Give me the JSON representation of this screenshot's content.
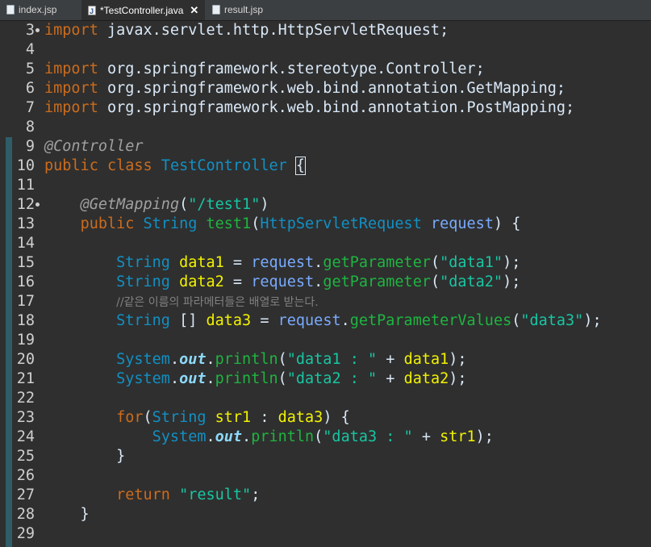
{
  "tabs": [
    {
      "label": "index.jsp",
      "icon": "jsp-file-icon",
      "active": false
    },
    {
      "label": "*TestController.java",
      "icon": "java-file-icon",
      "active": true,
      "close": "✕"
    },
    {
      "label": "result.jsp",
      "icon": "jsp-file-icon",
      "active": false
    }
  ],
  "lines": [
    {
      "n": "3",
      "fold": true,
      "tokens": [
        [
          "kw",
          "import"
        ],
        [
          "plain",
          " javax.servlet.http.HttpServletRequest;"
        ]
      ]
    },
    {
      "n": "4",
      "tokens": []
    },
    {
      "n": "5",
      "tokens": [
        [
          "kw",
          "import"
        ],
        [
          "plain",
          " org.springframework.stereotype.Controller;"
        ]
      ]
    },
    {
      "n": "6",
      "tokens": [
        [
          "kw",
          "import"
        ],
        [
          "plain",
          " org.springframework.web.bind.annotation.GetMapping;"
        ]
      ]
    },
    {
      "n": "7",
      "tokens": [
        [
          "kw",
          "import"
        ],
        [
          "plain",
          " org.springframework.web.bind.annotation.PostMapping;"
        ]
      ]
    },
    {
      "n": "8",
      "tokens": []
    },
    {
      "n": "9",
      "tokens": [
        [
          "ann",
          "@Controller"
        ]
      ]
    },
    {
      "n": "10",
      "tokens": [
        [
          "kw",
          "public"
        ],
        [
          "plain",
          " "
        ],
        [
          "kw",
          "class"
        ],
        [
          "plain",
          " "
        ],
        [
          "type",
          "TestController"
        ],
        [
          "plain",
          " "
        ],
        [
          "caret",
          "{"
        ]
      ]
    },
    {
      "n": "11",
      "tokens": []
    },
    {
      "n": "12",
      "fold": true,
      "tokens": [
        [
          "plain",
          "    "
        ],
        [
          "ann",
          "@GetMapping"
        ],
        [
          "plain",
          "("
        ],
        [
          "str",
          "\"/test1\""
        ],
        [
          "plain",
          ")"
        ]
      ]
    },
    {
      "n": "13",
      "tokens": [
        [
          "plain",
          "    "
        ],
        [
          "kw",
          "public"
        ],
        [
          "plain",
          " "
        ],
        [
          "type",
          "String"
        ],
        [
          "plain",
          " "
        ],
        [
          "method",
          "test1"
        ],
        [
          "plain",
          "("
        ],
        [
          "type",
          "HttpServletRequest"
        ],
        [
          "plain",
          " "
        ],
        [
          "param",
          "request"
        ],
        [
          "plain",
          ") {"
        ]
      ]
    },
    {
      "n": "14",
      "tokens": []
    },
    {
      "n": "15",
      "tokens": [
        [
          "plain",
          "        "
        ],
        [
          "type",
          "String"
        ],
        [
          "plain",
          " "
        ],
        [
          "var",
          "data1"
        ],
        [
          "plain",
          " = "
        ],
        [
          "param",
          "request"
        ],
        [
          "plain",
          "."
        ],
        [
          "method",
          "getParameter"
        ],
        [
          "plain",
          "("
        ],
        [
          "str",
          "\"data1\""
        ],
        [
          "plain",
          ");"
        ]
      ]
    },
    {
      "n": "16",
      "tokens": [
        [
          "plain",
          "        "
        ],
        [
          "type",
          "String"
        ],
        [
          "plain",
          " "
        ],
        [
          "var",
          "data2"
        ],
        [
          "plain",
          " = "
        ],
        [
          "param",
          "request"
        ],
        [
          "plain",
          "."
        ],
        [
          "method",
          "getParameter"
        ],
        [
          "plain",
          "("
        ],
        [
          "str",
          "\"data2\""
        ],
        [
          "plain",
          ");"
        ]
      ]
    },
    {
      "n": "17",
      "tokens": [
        [
          "plain",
          "        "
        ],
        [
          "cmt",
          "//같은 이름의 파라메터들은 배열로 받는다."
        ]
      ]
    },
    {
      "n": "18",
      "tokens": [
        [
          "plain",
          "        "
        ],
        [
          "type",
          "String"
        ],
        [
          "plain",
          " [] "
        ],
        [
          "var",
          "data3"
        ],
        [
          "plain",
          " = "
        ],
        [
          "param",
          "request"
        ],
        [
          "plain",
          "."
        ],
        [
          "method",
          "getParameterValues"
        ],
        [
          "plain",
          "("
        ],
        [
          "str",
          "\"data3\""
        ],
        [
          "plain",
          ");"
        ]
      ]
    },
    {
      "n": "19",
      "tokens": []
    },
    {
      "n": "20",
      "tokens": [
        [
          "plain",
          "        "
        ],
        [
          "type",
          "System"
        ],
        [
          "plain",
          "."
        ],
        [
          "field",
          "out"
        ],
        [
          "plain",
          "."
        ],
        [
          "method",
          "println"
        ],
        [
          "plain",
          "("
        ],
        [
          "str",
          "\"data1 : \""
        ],
        [
          "plain",
          " + "
        ],
        [
          "var",
          "data1"
        ],
        [
          "plain",
          ");"
        ]
      ]
    },
    {
      "n": "21",
      "tokens": [
        [
          "plain",
          "        "
        ],
        [
          "type",
          "System"
        ],
        [
          "plain",
          "."
        ],
        [
          "field",
          "out"
        ],
        [
          "plain",
          "."
        ],
        [
          "method",
          "println"
        ],
        [
          "plain",
          "("
        ],
        [
          "str",
          "\"data2 : \""
        ],
        [
          "plain",
          " + "
        ],
        [
          "var",
          "data2"
        ],
        [
          "plain",
          ");"
        ]
      ]
    },
    {
      "n": "22",
      "tokens": []
    },
    {
      "n": "23",
      "tokens": [
        [
          "plain",
          "        "
        ],
        [
          "kw",
          "for"
        ],
        [
          "plain",
          "("
        ],
        [
          "type",
          "String"
        ],
        [
          "plain",
          " "
        ],
        [
          "var",
          "str1"
        ],
        [
          "plain",
          " : "
        ],
        [
          "var",
          "data3"
        ],
        [
          "plain",
          ") {"
        ]
      ]
    },
    {
      "n": "24",
      "tokens": [
        [
          "plain",
          "            "
        ],
        [
          "type",
          "System"
        ],
        [
          "plain",
          "."
        ],
        [
          "field",
          "out"
        ],
        [
          "plain",
          "."
        ],
        [
          "method",
          "println"
        ],
        [
          "plain",
          "("
        ],
        [
          "str",
          "\"data3 : \""
        ],
        [
          "plain",
          " + "
        ],
        [
          "var",
          "str1"
        ],
        [
          "plain",
          ");"
        ]
      ]
    },
    {
      "n": "25",
      "tokens": [
        [
          "plain",
          "        }"
        ]
      ]
    },
    {
      "n": "26",
      "tokens": []
    },
    {
      "n": "27",
      "tokens": [
        [
          "plain",
          "        "
        ],
        [
          "kw",
          "return"
        ],
        [
          "plain",
          " "
        ],
        [
          "str",
          "\"result\""
        ],
        [
          "plain",
          ";"
        ]
      ]
    },
    {
      "n": "28",
      "tokens": [
        [
          "plain",
          "    }"
        ]
      ]
    },
    {
      "n": "29",
      "tokens": []
    }
  ],
  "colors": {
    "background": "#2f2f2f",
    "keyword": "#cc6c1d",
    "string": "#17c6a3",
    "type": "#1290c3",
    "method": "#1eb540",
    "variable": "#f2f200",
    "parameter": "#79abff",
    "annotation": "#a0a0a0",
    "comment": "#808080",
    "change-bar": "#2e5d68"
  }
}
